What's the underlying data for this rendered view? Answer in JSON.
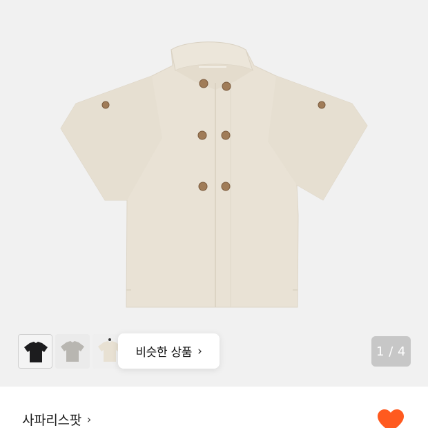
{
  "gallery": {
    "similar_label": "비슷한 상품",
    "similar_chevron": "›",
    "page_indicator": "1 / 4",
    "thumbnails": [
      {
        "name": "black",
        "color": "#1c1c1e"
      },
      {
        "name": "gray",
        "color": "#b8b6b1"
      },
      {
        "name": "beige",
        "color": "#e8e1d3"
      }
    ],
    "product_color": "#e9e2d5"
  },
  "brand": {
    "name": "사파리스팟",
    "chevron": "›"
  },
  "icons": {
    "similar": "chevron-right-icon",
    "brand": "chevron-right-icon",
    "wishlist": "heart-icon"
  },
  "colors": {
    "gallery_bg": "#f1f1f1",
    "accent": "#ff5a1f",
    "indicator_bg": "#c7c7c7"
  }
}
